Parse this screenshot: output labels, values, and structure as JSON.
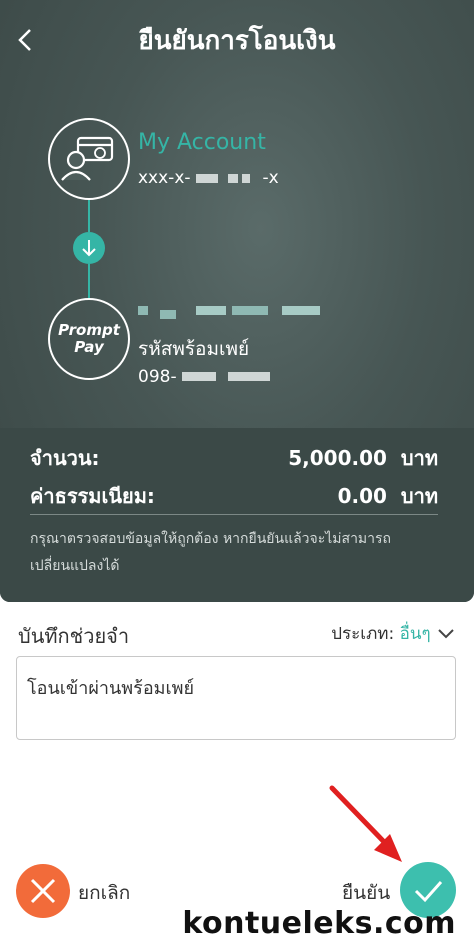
{
  "header": {
    "title": "ยืนยันการโอนเงิน"
  },
  "from": {
    "account_name": "My Account",
    "account_number": "xxx-x-",
    "account_suffix": "-x"
  },
  "to": {
    "label": "รหัสพร้อมเพย์",
    "number_prefix": "098-",
    "logo_line1": "Prompt",
    "logo_line2": "Pay"
  },
  "summary": {
    "amount_label": "จำนวน:",
    "amount_value": "5,000.00",
    "amount_unit": "บาท",
    "fee_label": "ค่าธรรมเนียม:",
    "fee_value": "0.00",
    "fee_unit": "บาท",
    "note": "กรุณาตรวจสอบข้อมูลให้ถูกต้อง หากยืนยันแล้วจะไม่สามารถเปลี่ยนแปลงได้"
  },
  "memo": {
    "label": "บันทึกช่วยจำ",
    "type_label": "ประเภท:",
    "type_value": "อื่นๆ",
    "text": "โอนเข้าผ่านพร้อมเพย์"
  },
  "actions": {
    "cancel_label": "ยกเลิก",
    "confirm_label": "ยืนยัน"
  },
  "watermark": "kontueleks.com",
  "colors": {
    "accent": "#35b5a6",
    "cancel": "#f26b3a",
    "confirm": "#3dbfae",
    "panel": "#475654"
  }
}
